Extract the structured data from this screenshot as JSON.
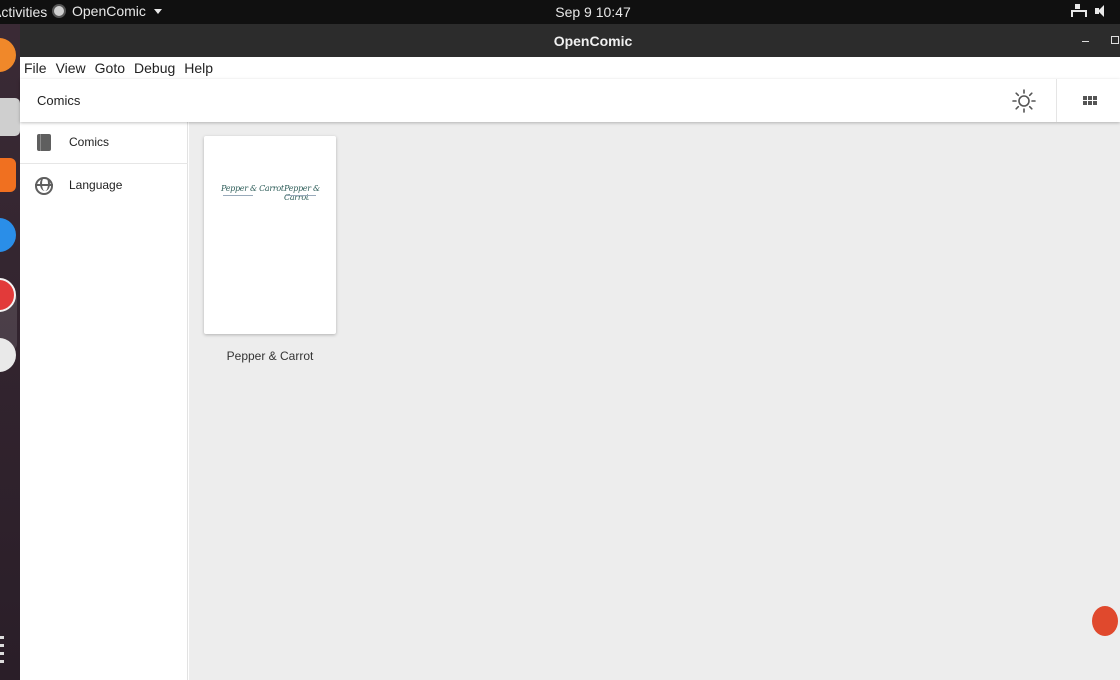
{
  "topbar": {
    "activities_label": "Activities",
    "app_name": "OpenComic",
    "clock": "Sep 9  10:47"
  },
  "window": {
    "title": "OpenComic"
  },
  "menubar": {
    "items": [
      "File",
      "View",
      "Goto",
      "Debug",
      "Help"
    ]
  },
  "header": {
    "section_title": "Comics"
  },
  "sidebar": {
    "items": [
      {
        "label": "Comics",
        "icon": "book-icon"
      },
      {
        "label": "Language",
        "icon": "globe-icon"
      }
    ]
  },
  "content": {
    "comics": [
      {
        "title": "Pepper & Carrot",
        "cover_text": "Pepper & Carrot"
      }
    ]
  },
  "colors": {
    "topbar": "#101010",
    "titlebar": "#2c2c2c",
    "content_bg": "#ededed",
    "fab": "#e0492d"
  }
}
